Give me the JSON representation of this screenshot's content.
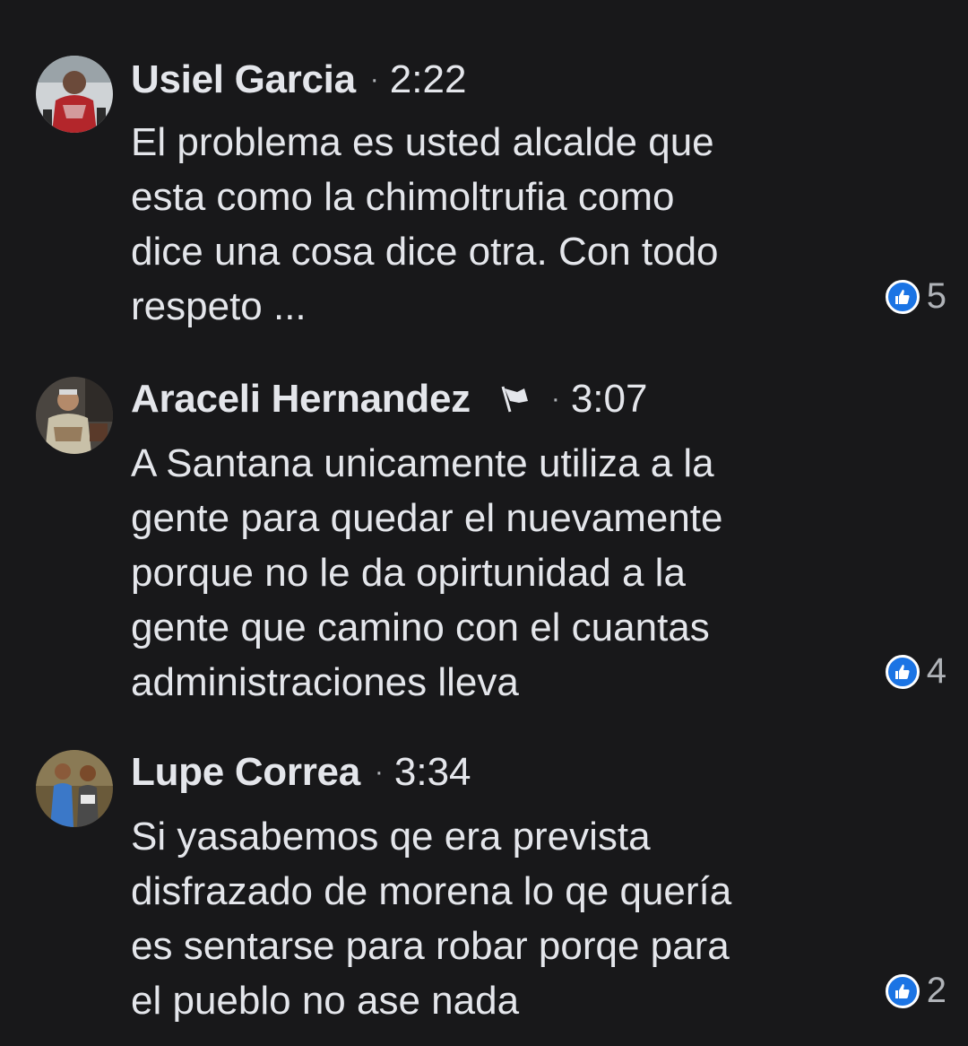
{
  "comments": [
    {
      "author": "Usiel Garcia",
      "time": "2:22",
      "lines": [
        "El problema es usted alcalde que",
        "esta como la chimoltrufia como",
        "dice una cosa dice otra. Con todo",
        "respeto ..."
      ],
      "likes": "5",
      "avatar_icon": "avatar-photo",
      "has_flag": false
    },
    {
      "author": "Araceli Hernandez",
      "time": "3:07",
      "lines": [
        "A Santana unicamente utiliza a la",
        "gente para quedar el nuevamente",
        "porque no le da opirtunidad a la",
        "gente que camino con el cuantas",
        "administraciones lleva"
      ],
      "likes": "4",
      "avatar_icon": "avatar-photo",
      "has_flag": true,
      "flag_icon": "flag-icon"
    },
    {
      "author": "Lupe Correa",
      "time": "3:34",
      "lines": [
        "Si yasabemos qe era prevista",
        "disfrazado de morena lo qe quería",
        "es sentarse para robar porqe para",
        "el pueblo no ase nada"
      ],
      "likes": "2",
      "avatar_icon": "avatar-photo",
      "has_flag": false
    }
  ],
  "separator": "·",
  "colors": {
    "background": "#18181a",
    "text": "#e4e6eb",
    "secondary_text": "#b0b3b8",
    "like_blue": "#1b74e4"
  }
}
